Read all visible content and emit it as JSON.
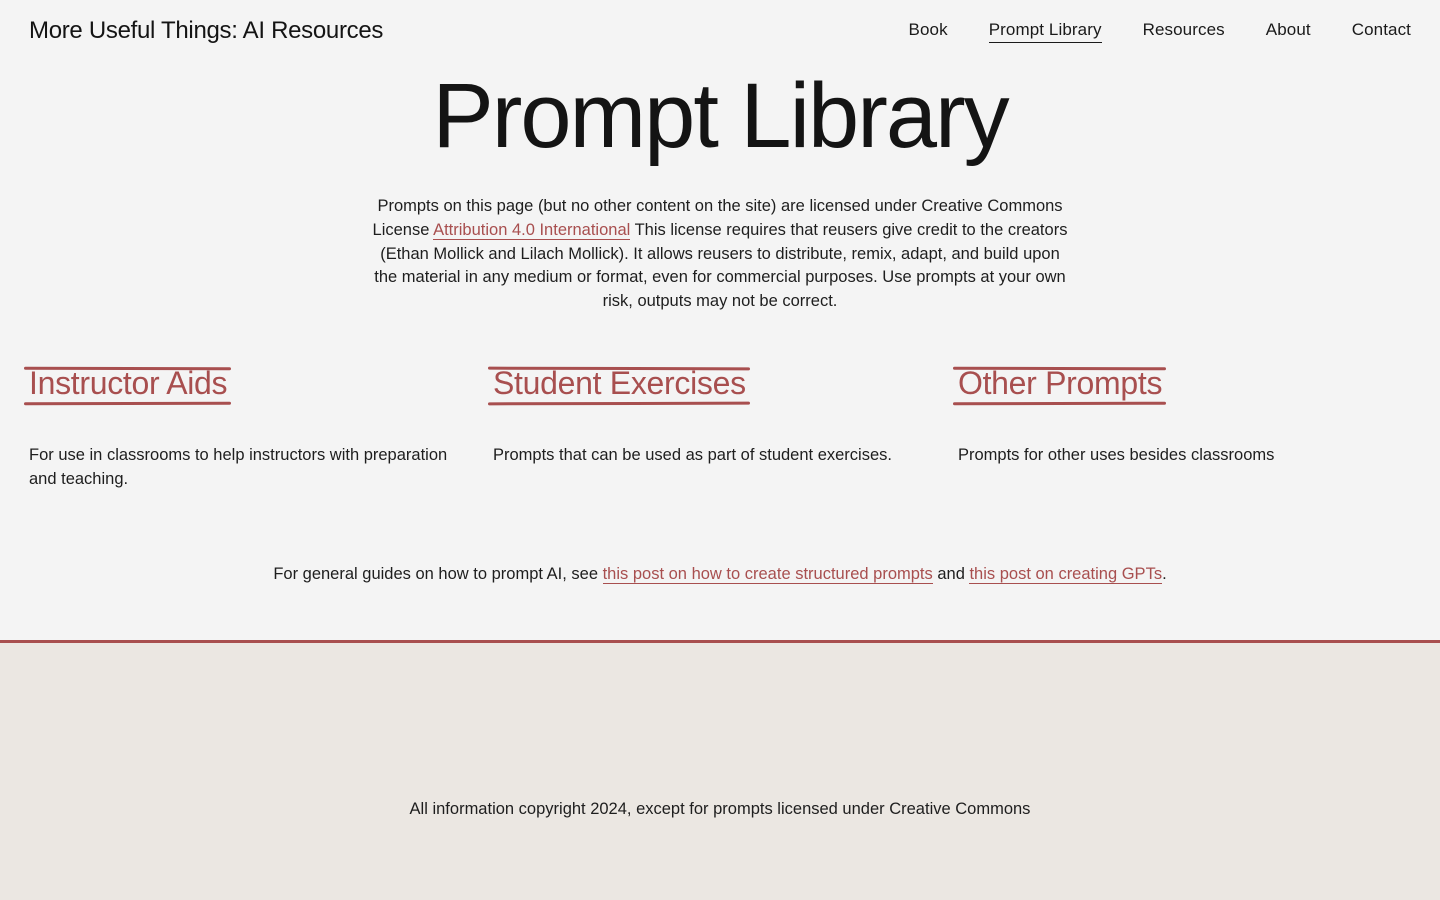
{
  "header": {
    "site_title": "More Useful Things: AI Resources",
    "nav": [
      {
        "label": "Book",
        "active": false
      },
      {
        "label": "Prompt Library",
        "active": true
      },
      {
        "label": "Resources",
        "active": false
      },
      {
        "label": "About",
        "active": false
      },
      {
        "label": "Contact",
        "active": false
      }
    ]
  },
  "main": {
    "title": "Prompt Library",
    "license": {
      "text_before": "Prompts on this page (but no other content on the site) are licensed under Creative Commons License ",
      "link_label": "Attribution 4.0 International",
      "text_after": " This license requires that reusers give credit to the creators (Ethan Mollick and Lilach Mollick). It allows reusers to distribute, remix, adapt, and build upon the material in any medium or format, even for commercial purposes. Use prompts at your own risk, outputs may not be correct."
    },
    "categories": [
      {
        "title": "Instructor Aids",
        "description": "For use in classrooms to help instructors with preparation and teaching."
      },
      {
        "title": "Student Exercises",
        "description": "Prompts that can be used as part of student exercises."
      },
      {
        "title": "Other Prompts",
        "description": "Prompts for other uses besides classrooms"
      }
    ],
    "guides": {
      "text_before": "For general guides on how to prompt AI, see ",
      "link1_label": "this post on how to create structured prompts",
      "text_middle": " and ",
      "link2_label": "this post on creating GPTs",
      "text_after": "."
    }
  },
  "footer": {
    "copyright": "All information copyright 2024, except for prompts licensed under Creative Commons"
  },
  "colors": {
    "accent": "#a84f4f",
    "background": "#f4f4f4",
    "footer_background": "#ebe7e2",
    "text": "#141414"
  }
}
